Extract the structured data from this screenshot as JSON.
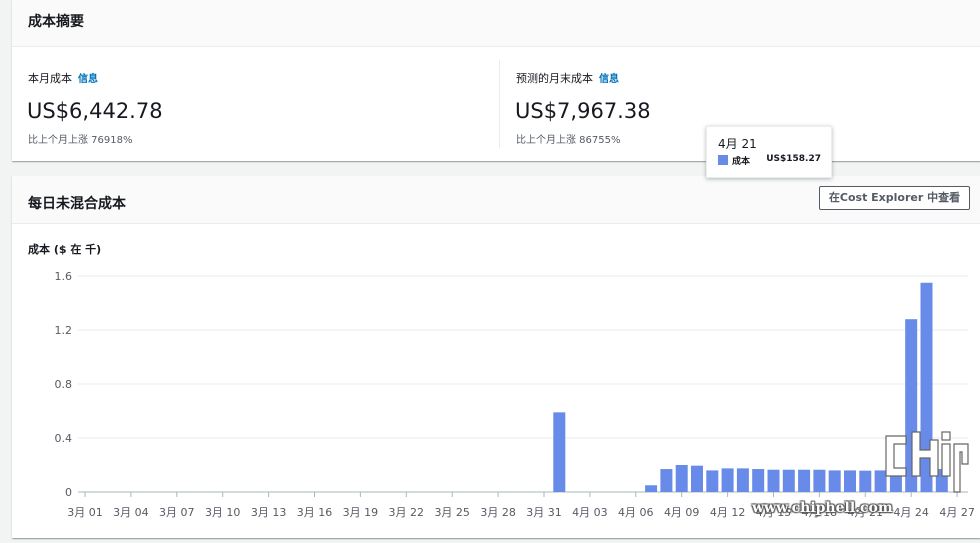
{
  "summary": {
    "title": "成本摘要",
    "current_month": {
      "label": "本月成本",
      "info": "信息",
      "value": "US$6,442.78",
      "change": "比上个月上涨 76918%"
    },
    "forecast": {
      "label": "预测的月末成本",
      "info": "信息",
      "value": "US$7,967.38",
      "change": "比上个月上涨 86755%"
    }
  },
  "daily": {
    "title": "每日未混合成本",
    "explorer_button": "在Cost Explorer 中查看",
    "y_axis_label": "成本 ($ 在 千)"
  },
  "tooltip": {
    "date": "4月 21",
    "series": "成本",
    "value": "US$158.27"
  },
  "watermark": "www.chiphell.com",
  "colors": {
    "bar": "#688ae8",
    "accent_link": "#0073bb",
    "grid": "#e9ebed"
  },
  "chart_data": {
    "type": "bar",
    "ylabel": "成本 ($ 在 千)",
    "ylim": [
      0,
      1.6
    ],
    "yticks": [
      "0",
      "0.4",
      "0.8",
      "1.2",
      "1.6"
    ],
    "ytick_values": [
      0,
      0.4,
      0.8,
      1.2,
      1.6
    ],
    "xtick_labels": [
      "3月 01",
      "3月 04",
      "3月 07",
      "3月 10",
      "3月 13",
      "3月 16",
      "3月 19",
      "3月 22",
      "3月 25",
      "3月 28",
      "3月 31",
      "4月 03",
      "4月 06",
      "4月 09",
      "4月 12",
      "4月 15",
      "4月 18",
      "4月 21",
      "4月 24",
      "4月 27"
    ],
    "xtick_days": [
      0,
      3,
      6,
      9,
      12,
      15,
      18,
      21,
      24,
      27,
      30,
      33,
      36,
      39,
      42,
      45,
      48,
      51,
      54,
      57
    ],
    "series": [
      {
        "values": [
          {
            "x": "4月 01",
            "y": 0.59
          },
          {
            "x": "4月 07",
            "y": 0.05
          },
          {
            "x": "4月 08",
            "y": 0.17
          },
          {
            "x": "4月 09",
            "y": 0.2
          },
          {
            "x": "4月 10",
            "y": 0.195
          },
          {
            "x": "4月 11",
            "y": 0.16
          },
          {
            "x": "4月 12",
            "y": 0.175
          },
          {
            "x": "4月 13",
            "y": 0.175
          },
          {
            "x": "4月 14",
            "y": 0.17
          },
          {
            "x": "4月 15",
            "y": 0.165
          },
          {
            "x": "4月 16",
            "y": 0.165
          },
          {
            "x": "4月 17",
            "y": 0.165
          },
          {
            "x": "4月 18",
            "y": 0.165
          },
          {
            "x": "4月 19",
            "y": 0.16
          },
          {
            "x": "4月 20",
            "y": 0.16
          },
          {
            "x": "4月 21",
            "y": 0.158
          },
          {
            "x": "4月 22",
            "y": 0.16
          },
          {
            "x": "4月 23",
            "y": 0.16
          },
          {
            "x": "4月 24",
            "y": 1.28
          },
          {
            "x": "4月 25",
            "y": 1.55
          },
          {
            "x": "4月 26",
            "y": 0.17
          }
        ]
      }
    ]
  }
}
